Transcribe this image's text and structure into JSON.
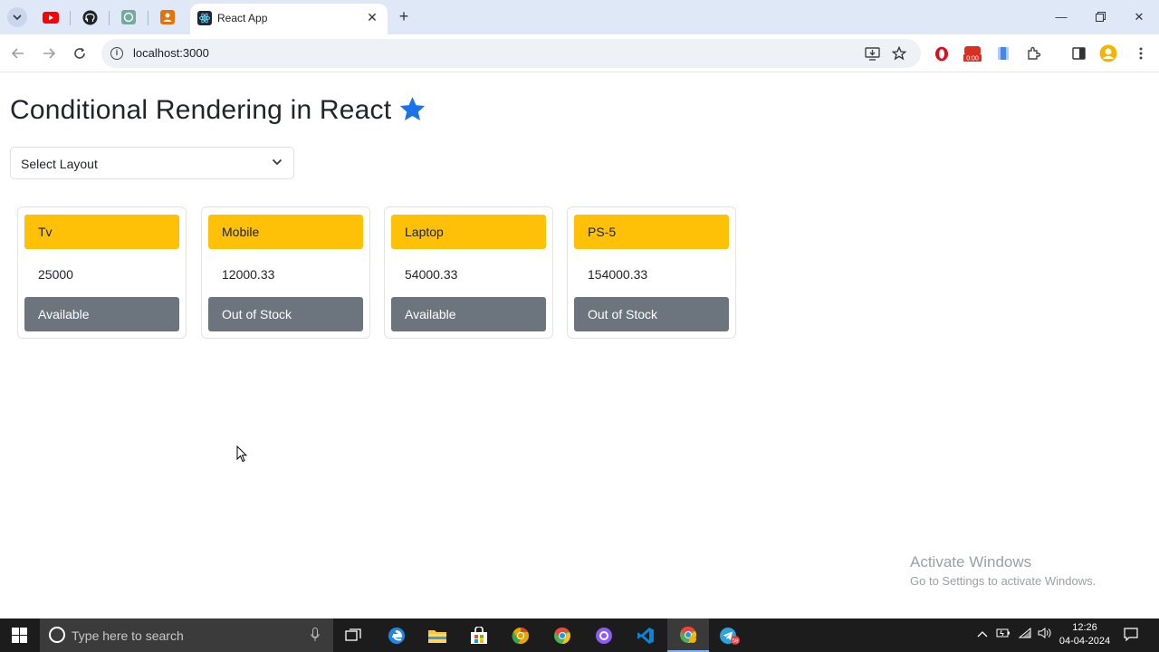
{
  "browser": {
    "active_tab_title": "React App",
    "new_tab_label": "+",
    "url": "localhost:3000",
    "extension_badge": "0:00"
  },
  "page": {
    "title": "Conditional Rendering in React",
    "title_icon": "star-icon",
    "layout_select": {
      "value": "Select Layout"
    },
    "products": [
      {
        "name": "Tv",
        "price": "25000",
        "status": "Available"
      },
      {
        "name": "Mobile",
        "price": "12000.33",
        "status": "Out of Stock"
      },
      {
        "name": "Laptop",
        "price": "54000.33",
        "status": "Available"
      },
      {
        "name": "PS-5",
        "price": "154000.33",
        "status": "Out of Stock"
      }
    ]
  },
  "watermark": {
    "line1": "Activate Windows",
    "line2": "Go to Settings to activate Windows."
  },
  "taskbar": {
    "search_placeholder": "Type here to search",
    "time": "12:26",
    "date": "04-04-2024",
    "notification_badge": "58"
  },
  "colors": {
    "card_header": "#ffc107",
    "card_footer": "#6c757d",
    "star": "#1a73e8",
    "tabbar": "#dfe8f7"
  }
}
